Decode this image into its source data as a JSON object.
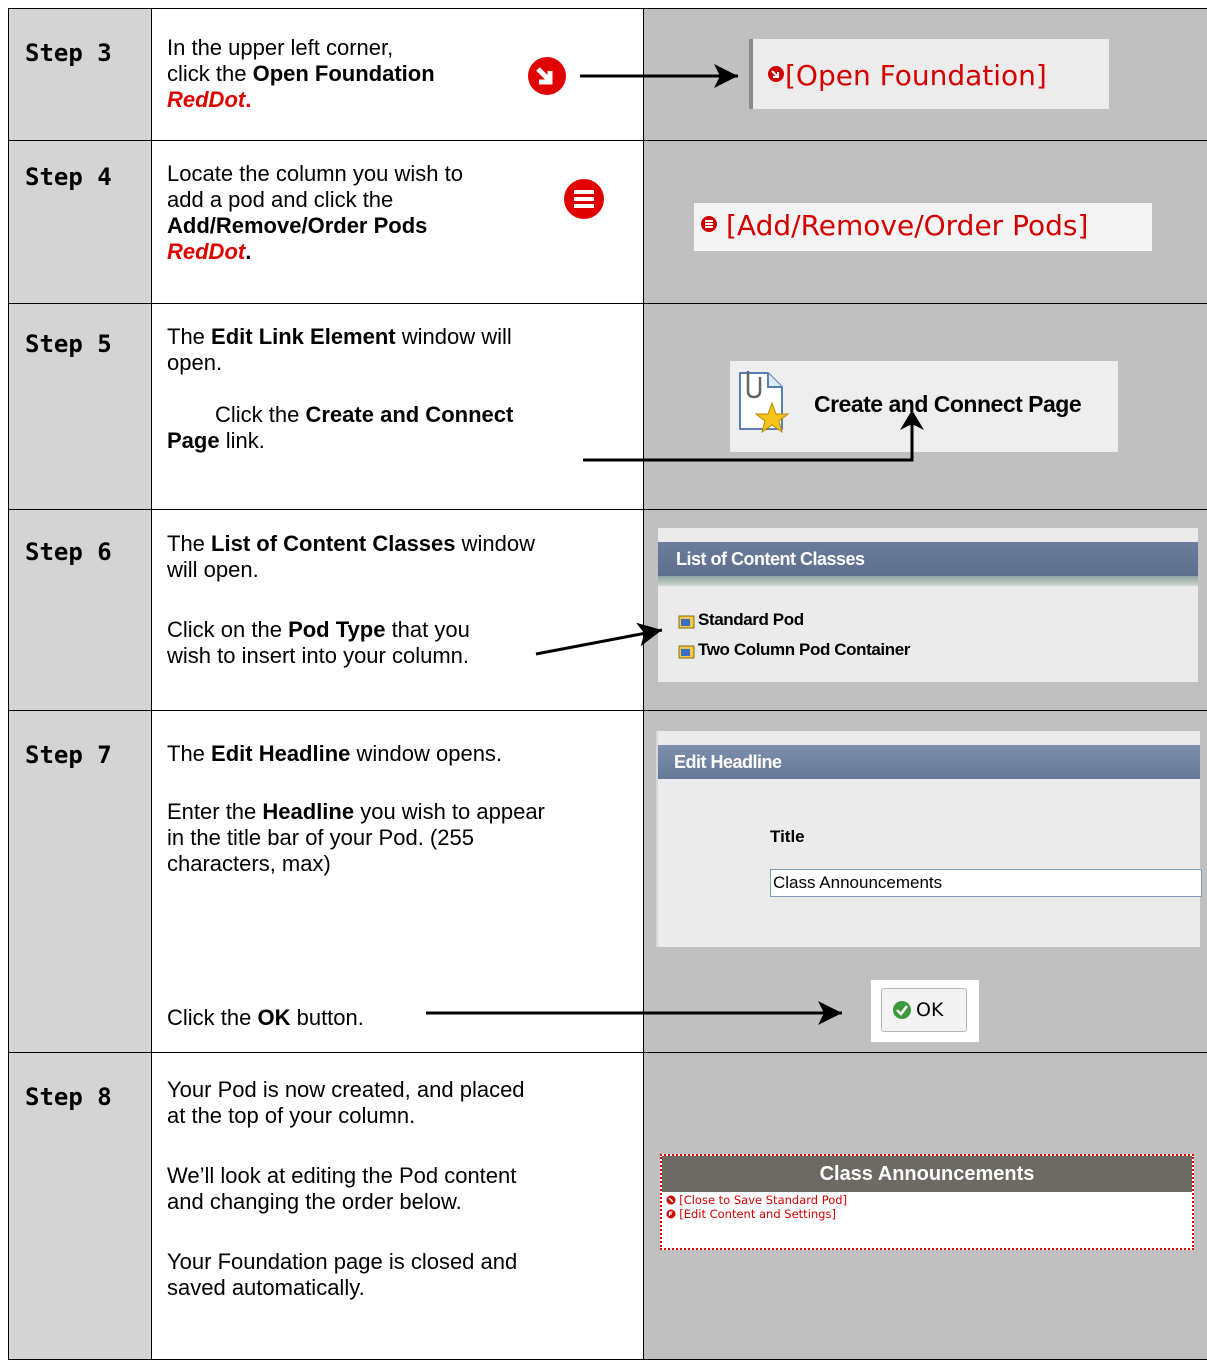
{
  "steps": [
    {
      "label": "Step 3",
      "line1": "In the upper left corner,",
      "line2a": "click the ",
      "line2b": "Open Foundation",
      "line3": "RedDot",
      "line3end": ".",
      "shot_link": "[Open Foundation]"
    },
    {
      "label": "Step 4",
      "line1": "Locate the column you wish to",
      "line2": "add a pod and click the",
      "line3": "Add/Remove/Order Pods",
      "line4": "RedDot",
      "line4end": ".",
      "shot_link": "[Add/Remove/Order Pods]"
    },
    {
      "label": "Step 5",
      "p1a": "The ",
      "p1b": "Edit Link Element",
      "p1c": " window will",
      "p1d": "open.",
      "p2a": "Click the ",
      "p2b": "Create and Connect",
      "p2c": "Page",
      "p2d": " link.",
      "shot_link": "Create and Connect Page"
    },
    {
      "label": "Step 6",
      "p1a": "The ",
      "p1b": "List of Content Classes",
      "p1c": " window",
      "p1d": "will open.",
      "p2a": "Click on the ",
      "p2b": "Pod Type",
      "p2c": " that you",
      "p2d": "wish to insert into your column.",
      "window_title": "List of Content Classes",
      "items": [
        "Standard Pod",
        "Two Column Pod Container"
      ]
    },
    {
      "label": "Step 7",
      "p1a": "The ",
      "p1b": "Edit Headline",
      "p1c": " window opens.",
      "p2a": "Enter the ",
      "p2b": "Headline",
      "p2c": " you wish to appear",
      "p2d": "in the title bar of your Pod. (255",
      "p2e": "characters, max)",
      "p3a": "Click the ",
      "p3b": "OK",
      "p3c": " button.",
      "window_title": "Edit Headline",
      "field_label": "Title",
      "field_value": "Class Announcements",
      "ok_label": "OK"
    },
    {
      "label": "Step 8",
      "p1": "Your Pod is now created, and placed",
      "p1b": "at the top of your column.",
      "p2": "We’ll look at editing the Pod content",
      "p2b": "and changing the order below.",
      "p3": "Your Foundation page is closed and",
      "p3b": "saved automatically.",
      "pod_title": "Class Announcements",
      "links": [
        "[Close to Save Standard Pod]",
        "[Edit Content and Settings]"
      ]
    }
  ]
}
